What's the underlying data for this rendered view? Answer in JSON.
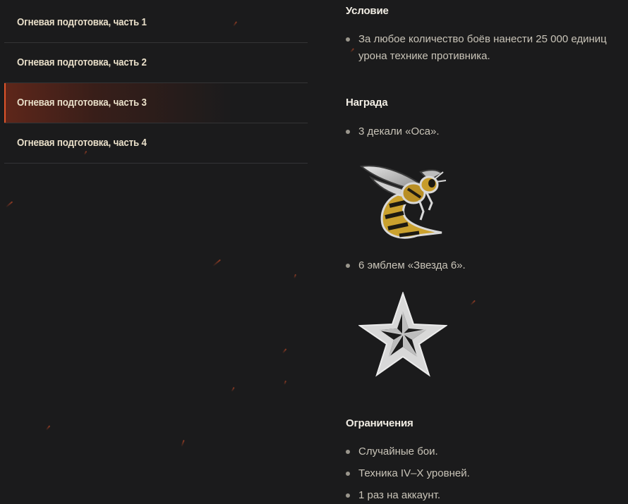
{
  "sidebar": {
    "items": [
      {
        "label": "Огневая подготовка, часть 1",
        "active": false
      },
      {
        "label": "Огневая подготовка, часть 2",
        "active": false
      },
      {
        "label": "Огневая подготовка, часть 3",
        "active": true
      },
      {
        "label": "Огневая подготовка, часть 4",
        "active": false
      }
    ]
  },
  "condition": {
    "title": "Условие",
    "items": [
      "За любое количество боёв нанести 25 000 единиц урона технике противника."
    ]
  },
  "reward": {
    "title": "Награда",
    "items": [
      {
        "text": "3 декали «Оса».",
        "icon": "wasp-decal-icon"
      },
      {
        "text": "6 эмблем «Звезда 6».",
        "icon": "star-emblem-icon"
      }
    ]
  },
  "restrictions": {
    "title": "Ограничения",
    "items": [
      "Случайные бои.",
      "Техника IV–X уровней.",
      "1 раз на аккаунт."
    ]
  },
  "colors": {
    "background": "#1b1b1c",
    "accent": "#e0552a",
    "nav_text": "#e9dfc9",
    "body_text": "#c9c4b8",
    "heading_text": "#f1ede4"
  }
}
